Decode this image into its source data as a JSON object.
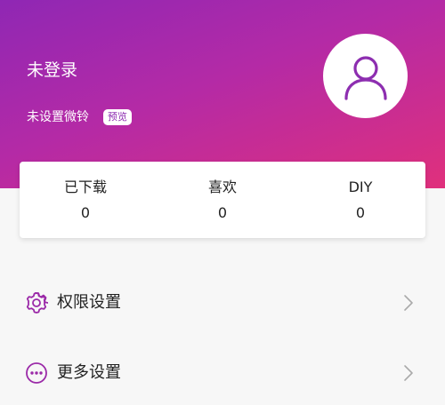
{
  "profile": {
    "username": "未登录",
    "ringtone_text": "未设置微铃",
    "preview_badge": "预览"
  },
  "stats": [
    {
      "label": "已下载",
      "value": "0"
    },
    {
      "label": "喜欢",
      "value": "0"
    },
    {
      "label": "DIY",
      "value": "0"
    }
  ],
  "menu": [
    {
      "label": "权限设置",
      "icon": "gear-icon"
    },
    {
      "label": "更多设置",
      "icon": "more-icon"
    }
  ],
  "colors": {
    "gradient_start": "#8f27b4",
    "gradient_end": "#e0307c",
    "accent": "#9b2aa8"
  }
}
